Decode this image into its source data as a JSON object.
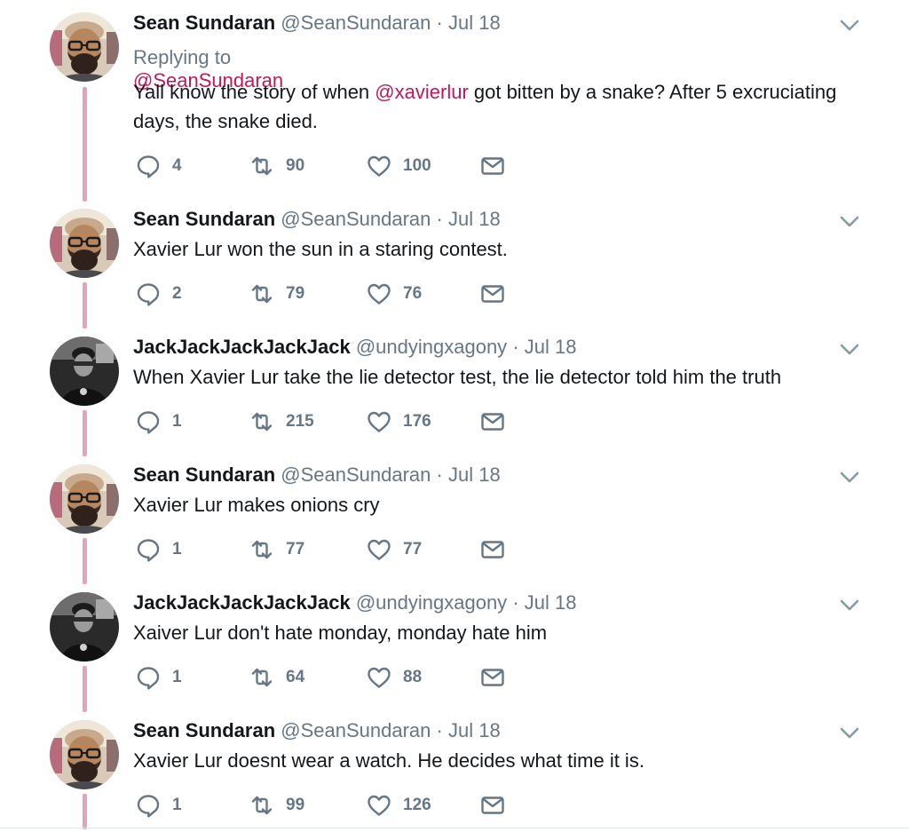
{
  "tweets": [
    {
      "name": "Sean Sundaran",
      "handle": "@SeanSundaran",
      "separator": "·",
      "date": "Jul 18",
      "replying_label": "Replying to",
      "replying_handle": "@SeanSundaran",
      "text_before": "Yall know the story of when ",
      "mention": "@xavierlur",
      "text_after": " got bitten by a snake? After 5 excruciating days, the snake died.",
      "replies": "4",
      "retweets": "90",
      "likes": "100",
      "avatar": "bearded-glasses-man"
    },
    {
      "name": "Sean Sundaran",
      "handle": "@SeanSundaran",
      "separator": "·",
      "date": "Jul 18",
      "text": "Xavier Lur won the sun in a staring contest.",
      "replies": "2",
      "retweets": "79",
      "likes": "76",
      "avatar": "bearded-glasses-man"
    },
    {
      "name": "JackJackJackJackJack",
      "handle": "@undyingxagony",
      "separator": "·",
      "date": "Jul 18",
      "text": "When Xavier Lur take the lie detector test, the lie detector told him the truth",
      "replies": "1",
      "retweets": "215",
      "likes": "176",
      "avatar": "dark-cap-man"
    },
    {
      "name": "Sean Sundaran",
      "handle": "@SeanSundaran",
      "separator": "·",
      "date": "Jul 18",
      "text": "Xavier Lur makes onions cry",
      "replies": "1",
      "retweets": "77",
      "likes": "77",
      "avatar": "bearded-glasses-man"
    },
    {
      "name": "JackJackJackJackJack",
      "handle": "@undyingxagony",
      "separator": "·",
      "date": "Jul 18",
      "text": "Xaiver Lur don't hate monday, monday hate him",
      "replies": "1",
      "retweets": "64",
      "likes": "88",
      "avatar": "dark-cap-man"
    },
    {
      "name": "Sean Sundaran",
      "handle": "@SeanSundaran",
      "separator": "·",
      "date": "Jul 18",
      "text": "Xavier Lur doesnt wear a watch. He decides what time it is.",
      "replies": "1",
      "retweets": "99",
      "likes": "126",
      "avatar": "bearded-glasses-man"
    }
  ],
  "colors": {
    "accent": "#c0185a",
    "thread_line": "#e3a3b8",
    "secondary_text": "#657786"
  },
  "icons": [
    "reply-icon",
    "retweet-icon",
    "like-icon",
    "direct-message-icon",
    "chevron-down-icon"
  ]
}
